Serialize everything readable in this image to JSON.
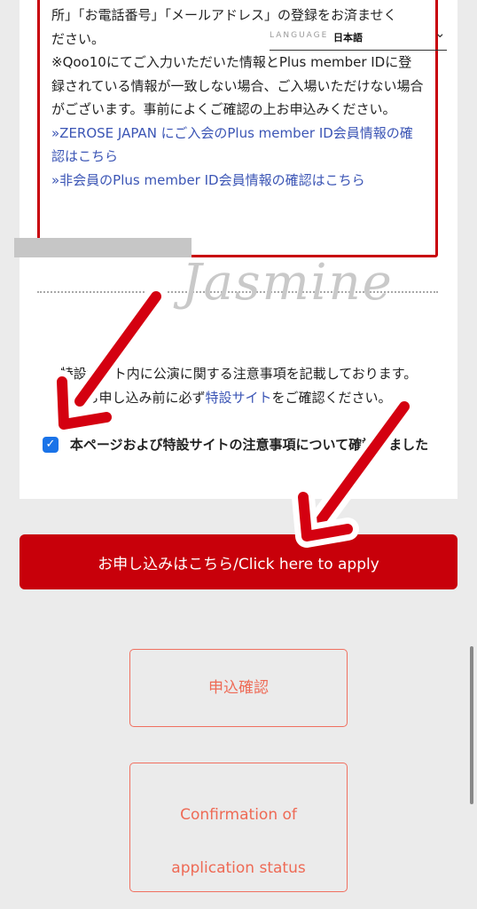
{
  "notice": {
    "line1": "所」「お電話番号」「メールアドレス」の登録をお済ませく",
    "line2": "ださい。",
    "warning": "※Qoo10にてご入力いただいた情報とPlus member IDに登録されている情報が一致しない場合、ご入場いただけない場合がございます。事前によくご確認の上お申込みください。",
    "link_member": "»ZEROSE JAPAN にご入会のPlus member ID会員情報の確認はこちら",
    "link_nonmember": "»非会員のPlus member ID会員情報の確認はこちら"
  },
  "language": {
    "label": "LANGUAGE",
    "value": "日本語"
  },
  "decor": {
    "script_text": "Jasmine"
  },
  "info": {
    "line1": "特設サイト内に公演に関する注意事項を記載しております。",
    "line2_before": "お申し込み前に必ず",
    "line2_link": "特設サイト",
    "line2_after": "をご確認ください。"
  },
  "agree": {
    "checked": true,
    "label": "本ページおよび特設サイトの注意事項について確認しました"
  },
  "apply_button": "お申し込みはこちら/Click here to apply",
  "confirm_jp_button": "申込確認",
  "confirm_en_button": {
    "line1": "Confirmation of",
    "line2": "application status"
  },
  "colors": {
    "accent_red": "#c8000a",
    "link_blue": "#3b55b5",
    "outline_orange": "#ee6a55"
  }
}
